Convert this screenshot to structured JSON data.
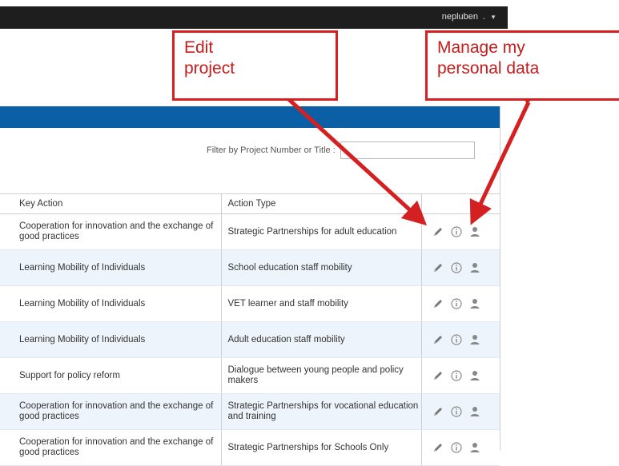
{
  "user": {
    "name": "nepluben",
    "suffix": ".",
    "caret": "▼"
  },
  "filter": {
    "label": "Filter by Project Number or Title :",
    "value": ""
  },
  "table": {
    "headers": [
      "Key Action",
      "Action Type"
    ],
    "rows": [
      {
        "key_action": "Cooperation for innovation and the exchange of good practices",
        "action_type": "Strategic Partnerships for adult education"
      },
      {
        "key_action": "Learning Mobility of Individuals",
        "action_type": "School education staff mobility"
      },
      {
        "key_action": "Learning Mobility of Individuals",
        "action_type": "VET learner and staff mobility"
      },
      {
        "key_action": "Learning Mobility of Individuals",
        "action_type": "Adult education staff mobility"
      },
      {
        "key_action": "Support for policy reform",
        "action_type": "Dialogue between young people and policy makers"
      },
      {
        "key_action": "Cooperation for innovation and the exchange of good practices",
        "action_type": "Strategic Partnerships for vocational education and training"
      },
      {
        "key_action": "Cooperation for innovation and the exchange of good practices",
        "action_type": "Strategic Partnerships for Schools Only"
      }
    ],
    "row_icons": [
      "pencil-icon",
      "info-icon",
      "person-icon"
    ]
  },
  "callouts": {
    "edit": {
      "line1": "Edit",
      "line2": "project"
    },
    "manage": {
      "line1": "Manage my",
      "line2": "personal data"
    }
  },
  "colors": {
    "header_bar": "#0b5fa5",
    "topbar": "#1e1e1e",
    "callout_red": "#d42020",
    "alt_row": "#eef4fb"
  }
}
